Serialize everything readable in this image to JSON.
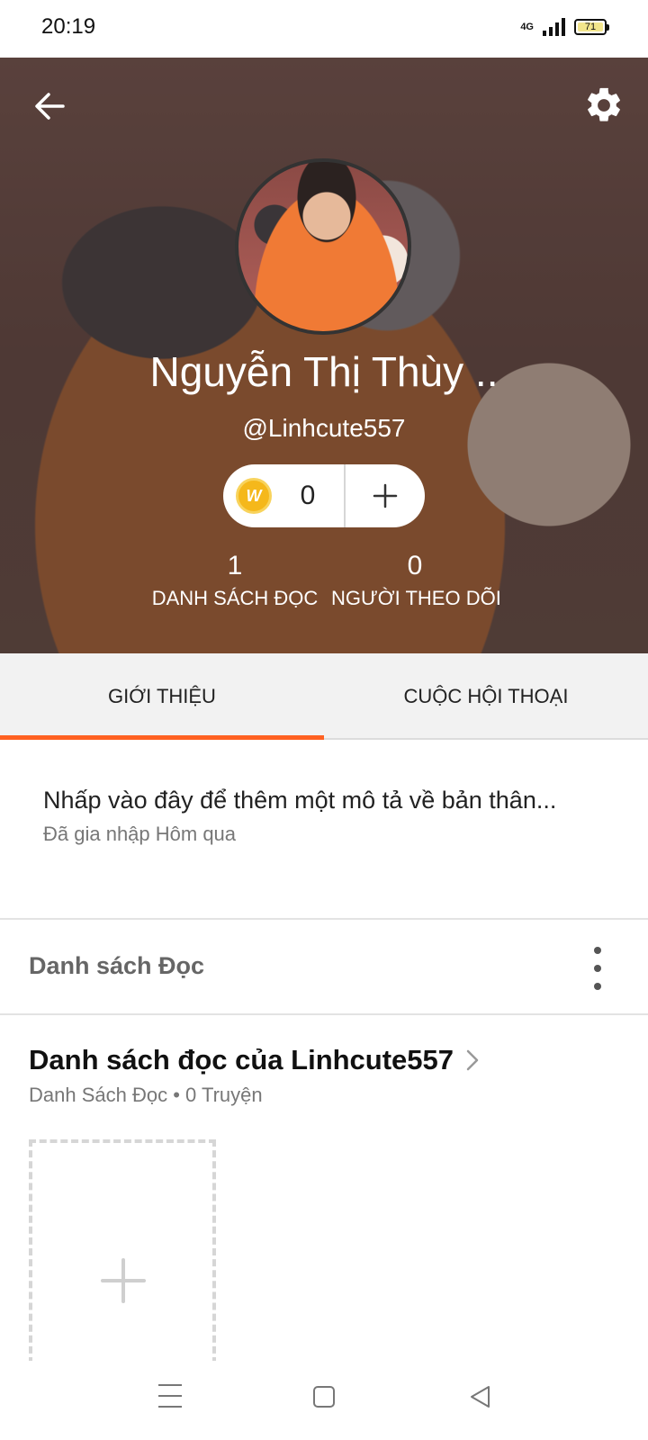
{
  "status_bar": {
    "time": "20:19",
    "network": "4G",
    "battery": "71"
  },
  "header": {
    "back_icon": "arrow-left-icon",
    "settings_icon": "gear-icon",
    "display_name": "Nguyễn Thị Thùy ..",
    "username": "@Linhcute557",
    "coins": {
      "icon": "w-coin-icon",
      "icon_letter": "W",
      "count": "0",
      "add_icon": "plus-icon"
    },
    "stats": [
      {
        "value": "1",
        "label": "DANH SÁCH ĐỌC"
      },
      {
        "value": "0",
        "label": "NGƯỜI THEO DÕI"
      }
    ]
  },
  "tabs": [
    {
      "label": "GIỚI THIỆU",
      "active": true
    },
    {
      "label": "CUỘC HỘI THOẠI",
      "active": false
    }
  ],
  "accent_color": "#ff6122",
  "about": {
    "description": "Nhấp vào đây để thêm một mô tả về bản thân...",
    "joined": "Đã gia nhập Hôm qua"
  },
  "reading_lists": {
    "section_title": "Danh sách Đọc",
    "more_icon": "more-vertical-icon",
    "item": {
      "title": "Danh sách đọc của Linhcute557",
      "meta": "Danh Sách Đọc • 0 Truyện",
      "add_icon": "plus-icon"
    }
  },
  "nav_bar": {
    "menu_icon": "menu-icon",
    "home_icon": "square-home-icon",
    "back_icon": "triangle-back-icon"
  }
}
